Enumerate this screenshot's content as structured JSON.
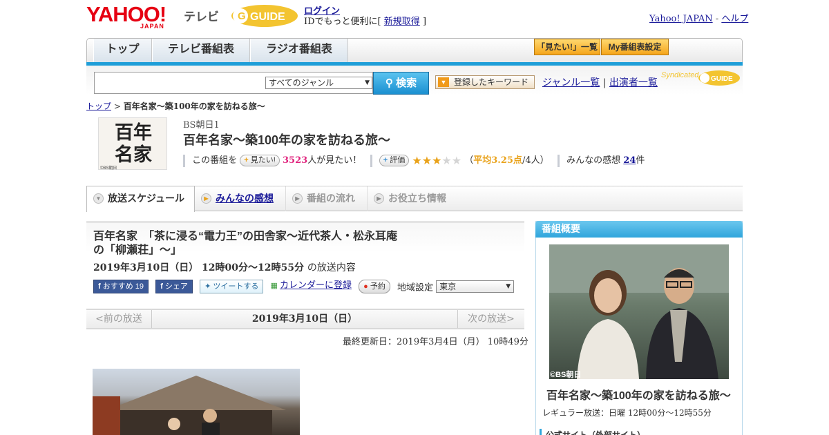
{
  "header": {
    "logo_text": "YAHOO!",
    "logo_sub": "JAPAN",
    "tv_label": "テレビ",
    "gguide_text": "GUIDE",
    "login_link": "ログイン",
    "login_sub_prefix": "IDでもっと便利に[",
    "register_link": "新規取得",
    "login_sub_suffix": "]",
    "yahoo_japan_link": "Yahoo! JAPAN",
    "separator": "-",
    "help_link": "ヘルプ"
  },
  "nav": {
    "tabs": [
      "トップ",
      "テレビ番組表",
      "ラジオ番組表"
    ],
    "mitai_list_button": "「見たい!」一覧",
    "my_schedule_button": "My番組表設定"
  },
  "search": {
    "input_value": "",
    "genre_select": "すべてのジャンル",
    "search_button": "検索",
    "keyword_button": "登録したキーワード",
    "genre_list_link": "ジャンル一覧",
    "divider": "|",
    "performer_list_link": "出演者一覧",
    "syndicated": "Syndicated",
    "gguide_small": "GUIDE"
  },
  "breadcrumb": {
    "top_link": "トップ",
    "sep": ">",
    "current": "百年名家～築100年の家を訪ねる旅～"
  },
  "program": {
    "logo_text": [
      "百年",
      "名家"
    ],
    "logo_caption": "©BS朝日",
    "channel": "BS朝日1",
    "title": "百年名家～築100年の家を訪ねる旅～",
    "stats_prefix": "この番組を",
    "mitai_pill": "見たい!",
    "mitai_count": "3523",
    "mitai_suffix": "人が見たい！",
    "rating_pill": "評価",
    "stars_on": 3,
    "stars_total": 5,
    "avg_prefix": "（",
    "avg_label": "平均3.25点",
    "avg_suffix": "/4人）",
    "reviews_prefix": "みんなの感想",
    "reviews_count": "24",
    "reviews_suffix": "件"
  },
  "tabs": {
    "schedule": "放送スケジュール",
    "reviews": "みんなの感想",
    "flow": "番組の流れ",
    "info": "お役立ち情報"
  },
  "episode": {
    "title_line1": "百年名家　「茶に浸る“電力王”の田舎家～近代茶人・松永耳庵",
    "title_line2": "の「柳瀬荘」～」",
    "date_time": "2019年3月10日（日）  12時00分～12時55分",
    "date_suffix": "の放送内容",
    "fb_recommend": "おすすめ",
    "fb_count": "19",
    "fb_share": "シェア",
    "tweet": "ツイートする",
    "calendar_link": "カレンダーに登録",
    "reserve": "予約",
    "region_label": "地域設定",
    "region_value": "東京",
    "prev": "<前の放送",
    "current_date": "2019年3月10日（日）",
    "next": "次の放送>",
    "updated": "最終更新日：2019年3月4日（月） 10時49分"
  },
  "sidebar": {
    "heading": "番組概要",
    "photo_caption": "©BS朝日",
    "title": "百年名家～築100年の家を訪ねる旅～",
    "schedule": "レギュラー放送：日曜 12時00分～12時55分",
    "official_site": "公式サイト（外部サイト）"
  },
  "colors": {
    "accent_blue": "#1e9ed8",
    "yahoo_red": "#e60012",
    "gguide_yellow": "#f3c430",
    "pink_count": "#e0237d",
    "star_gold": "#e9a21a"
  }
}
